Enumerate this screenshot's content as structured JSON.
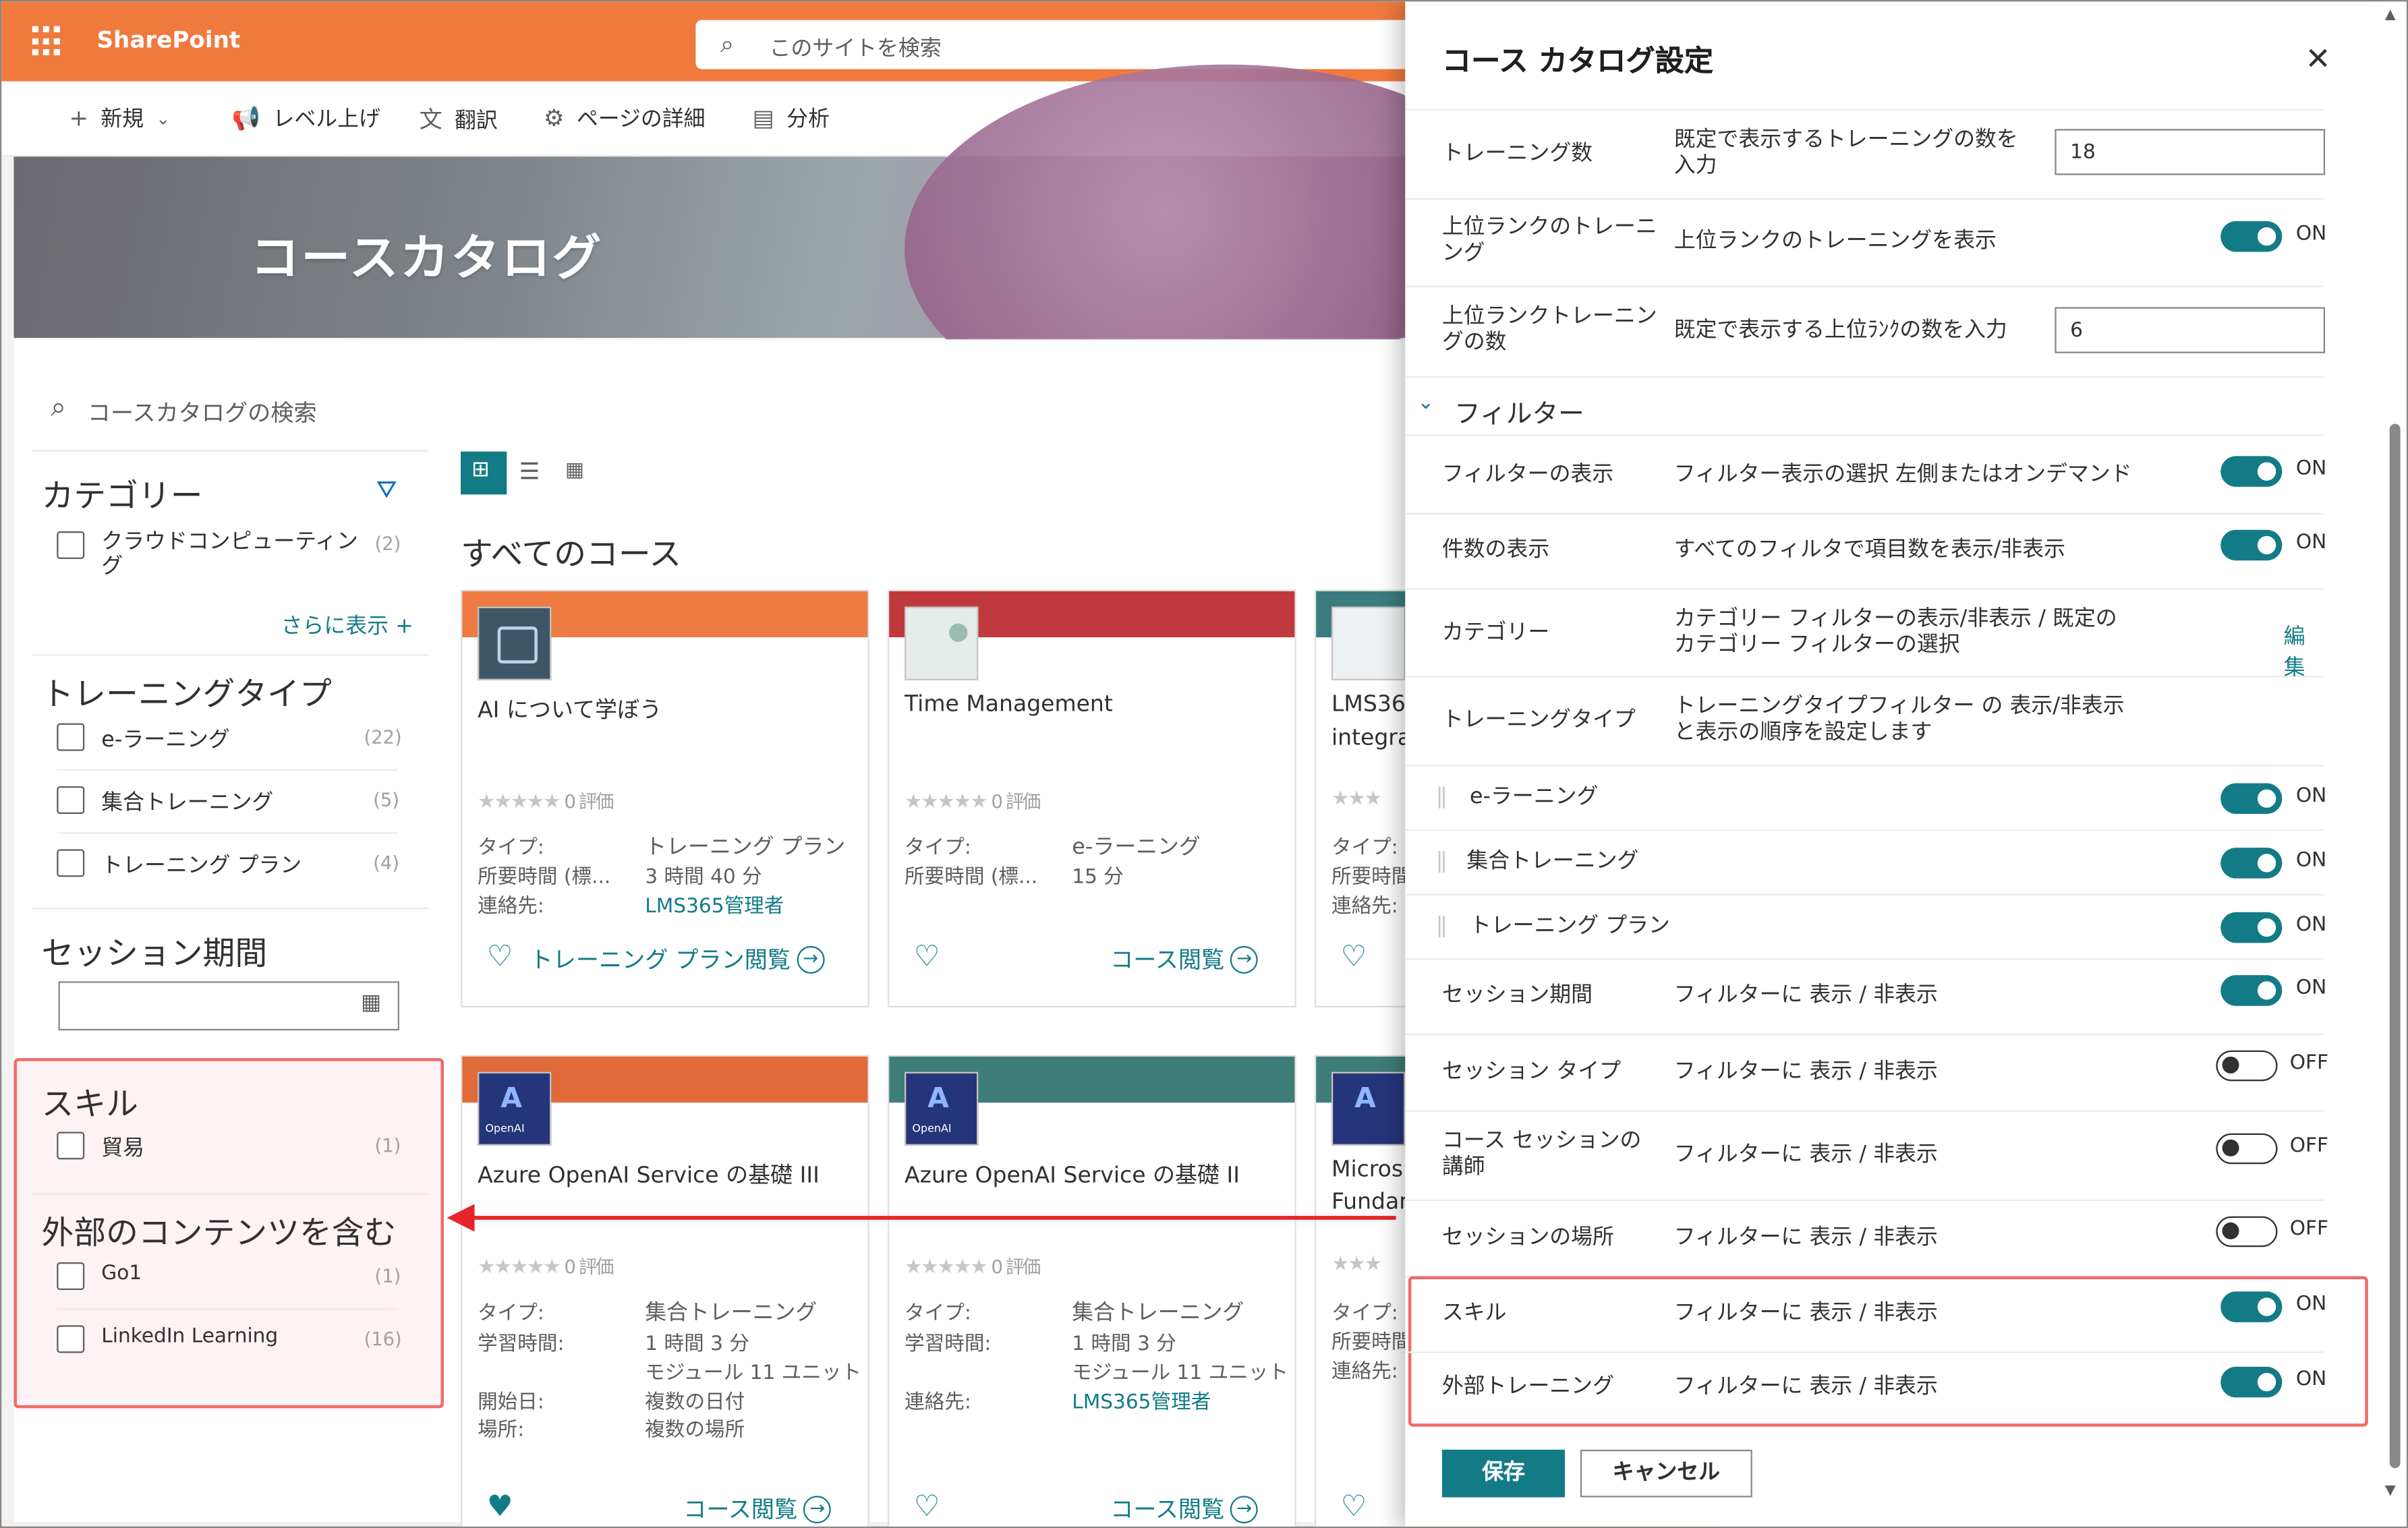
{
  "suite": {
    "brand": "SharePoint",
    "search_placeholder": "このサイトを検索"
  },
  "commands": {
    "new": "新規",
    "level_up": "レベル上げ",
    "translate": "翻訳",
    "page_details": "ページの詳細",
    "analytics": "分析"
  },
  "hero": {
    "title": "コースカタログ"
  },
  "left": {
    "search_placeholder": "コースカタログの検索",
    "category": {
      "heading": "カテゴリー",
      "items": [
        {
          "label": "クラウドコンピューティング",
          "count": "(2)"
        }
      ],
      "show_more": "さらに表示"
    },
    "training_type": {
      "heading": "トレーニングタイプ",
      "items": [
        {
          "label": "e-ラーニング",
          "count": "(22)"
        },
        {
          "label": "集合トレーニング",
          "count": "(5)"
        },
        {
          "label": "トレーニング プラン",
          "count": "(4)"
        }
      ]
    },
    "session_period": {
      "heading": "セッション期間"
    },
    "skills": {
      "heading": "スキル",
      "items": [
        {
          "label": "貿易",
          "count": "(1)"
        }
      ]
    },
    "external": {
      "heading": "外部のコンテンツを含む",
      "items": [
        {
          "label": "Go1",
          "count": "(1)"
        },
        {
          "label": "LinkedIn Learning",
          "count": "(16)"
        }
      ]
    }
  },
  "main": {
    "section_title": "すべてのコース",
    "cards": [
      {
        "title": "AI について学ぼう",
        "rating": "0 評価",
        "type_label": "タイプ:",
        "type": "トレーニング プラン",
        "k2": "所要時間 (標...",
        "v2": "3 時間 40 分",
        "k3": "連絡先:",
        "v3": "LMS365管理者",
        "action": "トレーニング プラン閲覧",
        "band": "#ee7b41"
      },
      {
        "title": "Time Management",
        "rating": "0 評価",
        "type_label": "タイプ:",
        "type": "e-ラーニング",
        "k2": "所要時間 (標...",
        "v2": "15 分",
        "action": "コース閲覧",
        "band": "#c0393d"
      },
      {
        "title": "LMS36",
        "title2": "integra",
        "k1": "タイプ:",
        "k2": "所要時間",
        "k3": "連絡先:",
        "band": "#3b7c7f"
      },
      {
        "title": "Azure OpenAI Service の基礎 III",
        "rating": "0 評価",
        "type_label": "タイプ:",
        "type": "集合トレーニング",
        "k2": "学習時間:",
        "v2": "1 時間 3 分",
        "v2b": "モジュール 11 ユニット",
        "k3": "開始日:",
        "v3": "複数の日付",
        "k4": "場所:",
        "v4": "複数の場所",
        "action": "コース閲覧",
        "band": "#e06a39"
      },
      {
        "title": "Azure OpenAI Service の基礎 II",
        "rating": "0 評価",
        "type_label": "タイプ:",
        "type": "集合トレーニング",
        "k2": "学習時間:",
        "v2": "1 時間 3 分",
        "v2b": "モジュール 11 ユニット",
        "k3": "連絡先:",
        "v3": "LMS365管理者",
        "action": "コース閲覧",
        "band": "#3f7d79"
      },
      {
        "title": "Micros",
        "title2": "Fundar",
        "k1": "タイプ:",
        "k2": "所要時間",
        "k3": "連絡先:",
        "band": "#3f7d79"
      }
    ],
    "thumb_label": "OpenAI"
  },
  "settings": {
    "title": "コース カタログ設定",
    "rows": {
      "training_count": {
        "label": "トレーニング数",
        "desc1": "既定で表示するトレーニングの数を",
        "desc2": "入力",
        "value": "18"
      },
      "top_ranked": {
        "label1": "上位ランクのトレーニ",
        "label2": "ング",
        "desc": "上位ランクのトレーニングを表示",
        "state": "ON"
      },
      "top_ranked_count": {
        "label1": "上位ランクトレーニン",
        "label2": "グの数",
        "desc": "既定で表示する上位ﾗﾝｸの数を入力",
        "value": "6"
      },
      "filter_section": "フィルター",
      "filter_display": {
        "label": "フィルターの表示",
        "desc": "フィルター表示の選択 左側またはオンデマンド",
        "state": "ON"
      },
      "count_display": {
        "label": "件数の表示",
        "desc": "すべてのフィルタで項目数を表示/非表示",
        "state": "ON"
      },
      "category": {
        "label": "カテゴリー",
        "desc1": "カテゴリー フィルターの表示/非表示 / 既定の",
        "desc2": "カテゴリー フィルターの選択",
        "edit": "編集"
      },
      "training_type": {
        "label": "トレーニングタイプ",
        "desc1": "トレーニングタイプフィルター の 表示/非表示",
        "desc2": "と表示の順序を設定します"
      },
      "sub_elearning": {
        "label": "e-ラーニング",
        "state": "ON"
      },
      "sub_group": {
        "label": "集合トレーニング",
        "state": "ON"
      },
      "sub_plan": {
        "label": "トレーニング プラン",
        "state": "ON"
      },
      "session_period": {
        "label": "セッション期間",
        "desc": "フィルターに 表示 / 非表示",
        "state": "ON"
      },
      "session_type": {
        "label": "セッション タイプ",
        "desc": "フィルターに 表示 / 非表示",
        "state": "OFF"
      },
      "instructor": {
        "label1": "コース セッションの",
        "label2": "講師",
        "desc": "フィルターに 表示 / 非表示",
        "state": "OFF"
      },
      "location": {
        "label": "セッションの場所",
        "desc": "フィルターに 表示 / 非表示",
        "state": "OFF"
      },
      "skills": {
        "label": "スキル",
        "desc": "フィルターに 表示 / 非表示",
        "state": "ON"
      },
      "external": {
        "label": "外部トレーニング",
        "desc": "フィルターに 表示 / 非表示",
        "state": "ON"
      }
    },
    "save": "保存",
    "cancel": "キャンセル"
  },
  "colors": {
    "accent": "#137b86",
    "suitebar": "#f07a3e",
    "highlight": "#f16a6a",
    "arrow": "#e8242b"
  }
}
